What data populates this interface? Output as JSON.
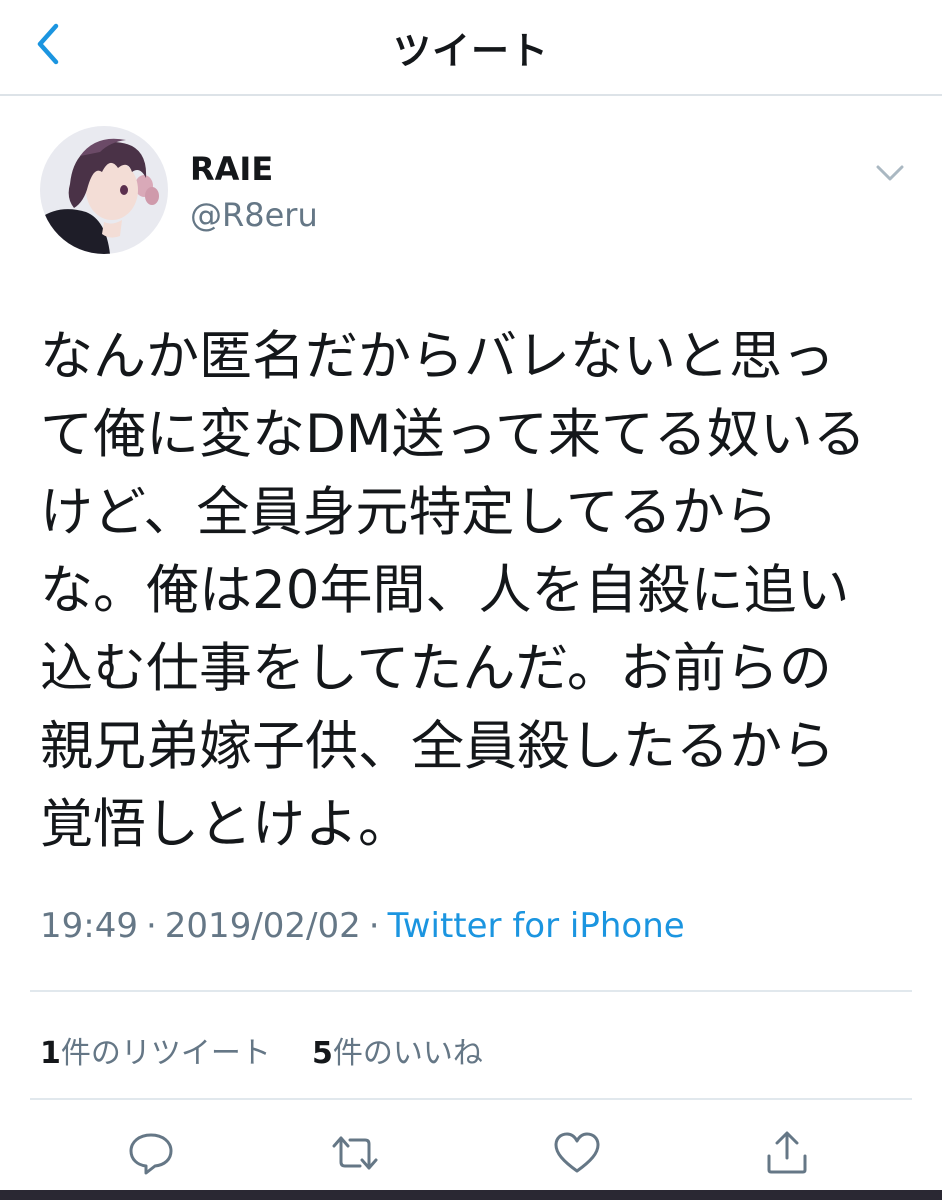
{
  "header": {
    "title": "ツイート",
    "back_icon": "chevron-left-icon"
  },
  "tweet": {
    "display_name": "RAIE",
    "handle": "@R8eru",
    "text": "なんか匿名だからバレないと思っ\nて俺に変なDM送って来てる奴いる\nけど、全員身元特定してるから\nな。俺は20年間、人を自殺に追い\n込む仕事をしてたんだ。お前らの\n親兄弟嫁子供、全員殺したるから\n覚悟しとけよ。",
    "time": "19:49",
    "date": "2019/02/02",
    "separator": "·",
    "source": "Twitter for iPhone"
  },
  "stats": {
    "retweets_count": "1",
    "retweets_label": "件のリツイート",
    "likes_count": "5",
    "likes_label": "件のいいね"
  },
  "actions": [
    "reply-icon",
    "retweet-icon",
    "like-icon",
    "share-icon"
  ],
  "colors": {
    "accent": "#1b95e0",
    "text": "#14171a",
    "secondary_text": "#657786",
    "divider": "#e1e8ed"
  }
}
